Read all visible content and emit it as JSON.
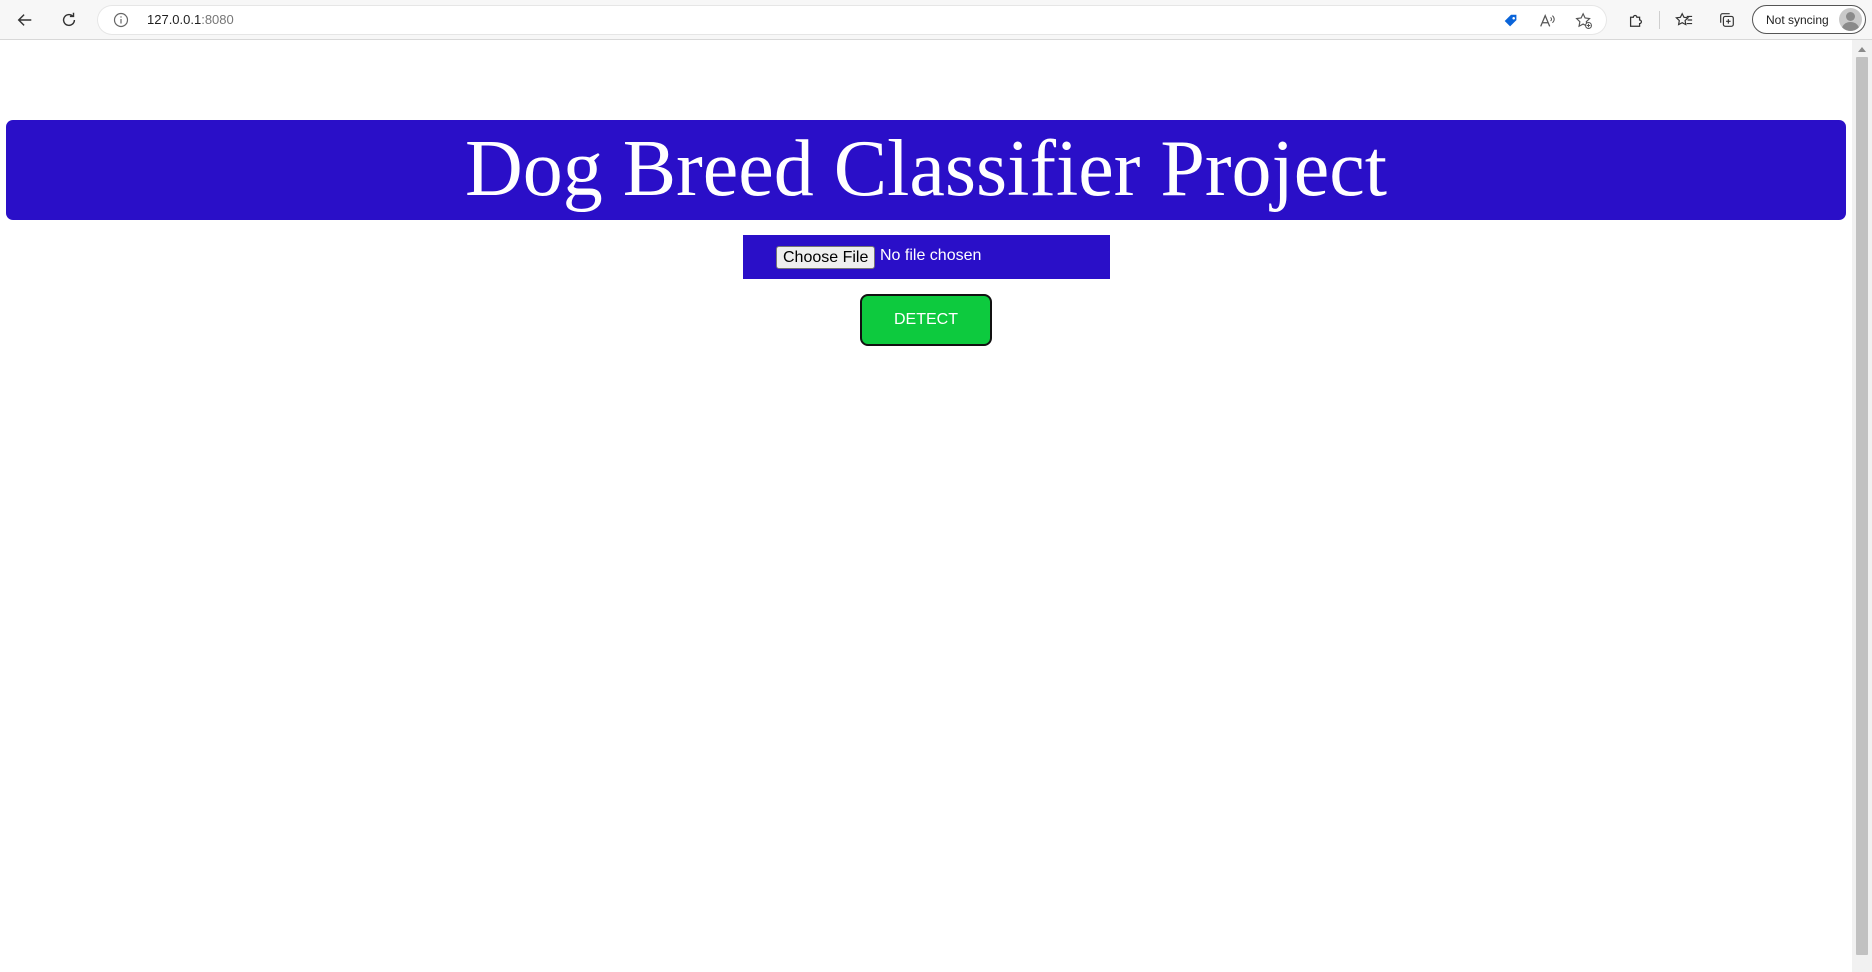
{
  "browser": {
    "url_host": "127.0.0.1",
    "url_port": ":8080",
    "profile_label": "Not syncing",
    "icons": [
      "back-arrow-icon",
      "refresh-icon",
      "info-icon",
      "shopping-tag-icon",
      "read-aloud-icon",
      "add-favorite-icon",
      "extensions-icon",
      "favorites-icon",
      "collections-icon"
    ],
    "accent_color": "#0a64d9"
  },
  "page": {
    "title": "Dog Breed Classifier Project",
    "banner_color": "#2a0fc8",
    "file_input": {
      "button_label": "Choose File",
      "status": "No file chosen"
    },
    "detect_button": {
      "label": "DETECT",
      "color": "#0dca3e"
    }
  }
}
